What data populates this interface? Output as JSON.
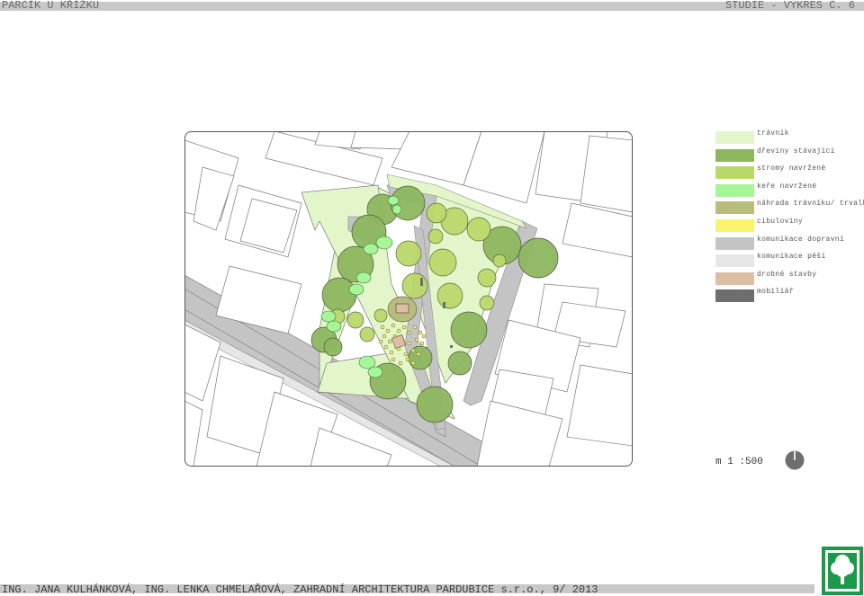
{
  "header": {
    "project_title": "PARČÍK U KŘÍŽKU",
    "sheet_label": "STUDIE - VÝKRES Č. 6"
  },
  "legend": [
    {
      "label": "trávník",
      "color": "#e3f6c9"
    },
    {
      "label": "dřeviny stávající",
      "color": "#8db65f"
    },
    {
      "label": "stromy navržené",
      "color": "#b9d86a"
    },
    {
      "label": "keře navržené",
      "color": "#a6f598"
    },
    {
      "label": "náhrada trávníku/ trvalky",
      "color": "#b8bc7e"
    },
    {
      "label": "cibuloviny",
      "color": "#fbf26e"
    },
    {
      "label": "komunikace dopravní",
      "color": "#c4c4c4"
    },
    {
      "label": "komunikace pěší",
      "color": "#e6e6e6"
    },
    {
      "label": "drobné stavby",
      "color": "#dcbfa3"
    },
    {
      "label": "mobiliář",
      "color": "#6e6e6e"
    }
  ],
  "scale": {
    "label": "m 1 :500"
  },
  "footer": {
    "credits": "ING. JANA KULHÁNKOVÁ, ING. LENKA CHMELAŘOVÁ, ZAHRADNÍ ARCHITEKTURA PARDUBICE s.r.o., 9/ 2013"
  },
  "icons": {
    "north_arrow": "north-arrow-icon",
    "logo": "tree-logo-icon"
  }
}
